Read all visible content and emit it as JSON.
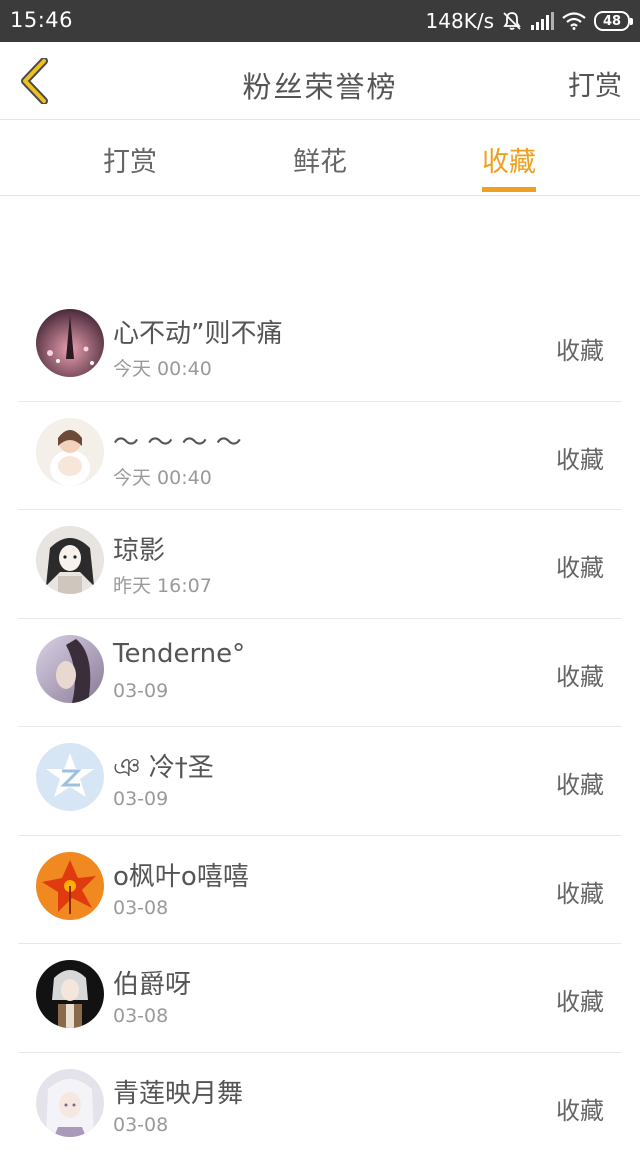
{
  "status_bar": {
    "time": "15:46",
    "network_speed": "148K/s",
    "battery": "48"
  },
  "header": {
    "title": "粉丝荣誉榜",
    "action_label": "打赏"
  },
  "tabs": [
    {
      "label": "打赏"
    },
    {
      "label": "鲜花"
    },
    {
      "label": "收藏"
    }
  ],
  "active_tab": "收藏",
  "colors": {
    "accent": "#f0a020",
    "status_bar": "#3b3b3b",
    "text": "#555555",
    "subtext": "#9a9a9a"
  },
  "fans": [
    {
      "name": "心不动”则不痛",
      "time": "今天 00:40",
      "tag": "收藏"
    },
    {
      "name": "～ ～ ～ ～",
      "time": "今天 00:40",
      "tag": "收藏"
    },
    {
      "name": "琼影",
      "time": "昨天 16:07",
      "tag": "收藏"
    },
    {
      "name": "Tenderne°",
      "time": "03-09",
      "tag": "收藏"
    },
    {
      "name": "ঞ 冷†圣",
      "time": "03-09",
      "tag": "收藏"
    },
    {
      "name": "o枫叶o嘻嘻",
      "time": "03-08",
      "tag": "收藏"
    },
    {
      "name": "伯爵呀",
      "time": "03-08",
      "tag": "收藏"
    },
    {
      "name": "青莲映月舞",
      "time": "03-08",
      "tag": "收藏"
    }
  ]
}
